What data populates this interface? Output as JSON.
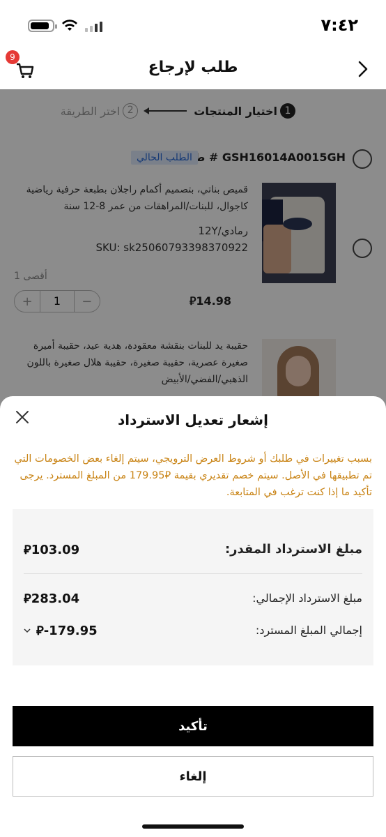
{
  "status_bar": {
    "time": "٧:٤٢"
  },
  "header": {
    "title": "طلب لإرجاع",
    "cart_badge": "9"
  },
  "steps": [
    {
      "num": "1",
      "label": "اختيار المنتجات"
    },
    {
      "num": "2",
      "label": "اختر الطريقة"
    }
  ],
  "order": {
    "label": "طلب # GSH16014A0015GH",
    "tag": "الطلب الحالي"
  },
  "products": [
    {
      "description": "قميص بناتي، بتصميم أكمام راجلان بطبعة حرفية رياضية كاجوال، للبنات/المراهقات من عمر 8-12 سنة",
      "attributes": "رمادي/12Y",
      "sku": "SKU: sk25060793398370922",
      "max_label": "أقصى 1",
      "quantity": "1",
      "price": "14.98"
    },
    {
      "description": "حقيبة يد للبنات بنقشة معقودة، هدية عيد، حقيبة أميرة صغيرة عصرية، حقيبة صغيرة، حقيبة هلال صغيرة باللون الذهبي/الفضي/الأبيض"
    }
  ],
  "modal": {
    "title": "إشعار تعديل الاسترداد",
    "notice_parts": [
      "بسبب تغييرات في طلبك أو شروط العرض الترويجي، سيتم إلغاء بعض الخصومات التي تم تطبيقها في الأصل. سيتم خصم تقديري بقيمة ",
      "179.95",
      " من المبلغ المسترد. يرجى تأكيد ما إذا كنت ترغب في المتابعة."
    ],
    "estimated_label": "مبلغ الاسترداد المقدر:",
    "estimated_amount": "103.09",
    "total_label": "مبلغ الاسترداد الإجمالي:",
    "total_amount": "283.04",
    "deduction_label": "إجمالي المبلغ المسترد:",
    "deduction_amount": "-179.95",
    "confirm_label": "تأكيد",
    "cancel_label": "إلغاء"
  },
  "colors": {
    "notice": "#c98416",
    "badge": "#e53935",
    "tag": "#2a6bd6"
  }
}
